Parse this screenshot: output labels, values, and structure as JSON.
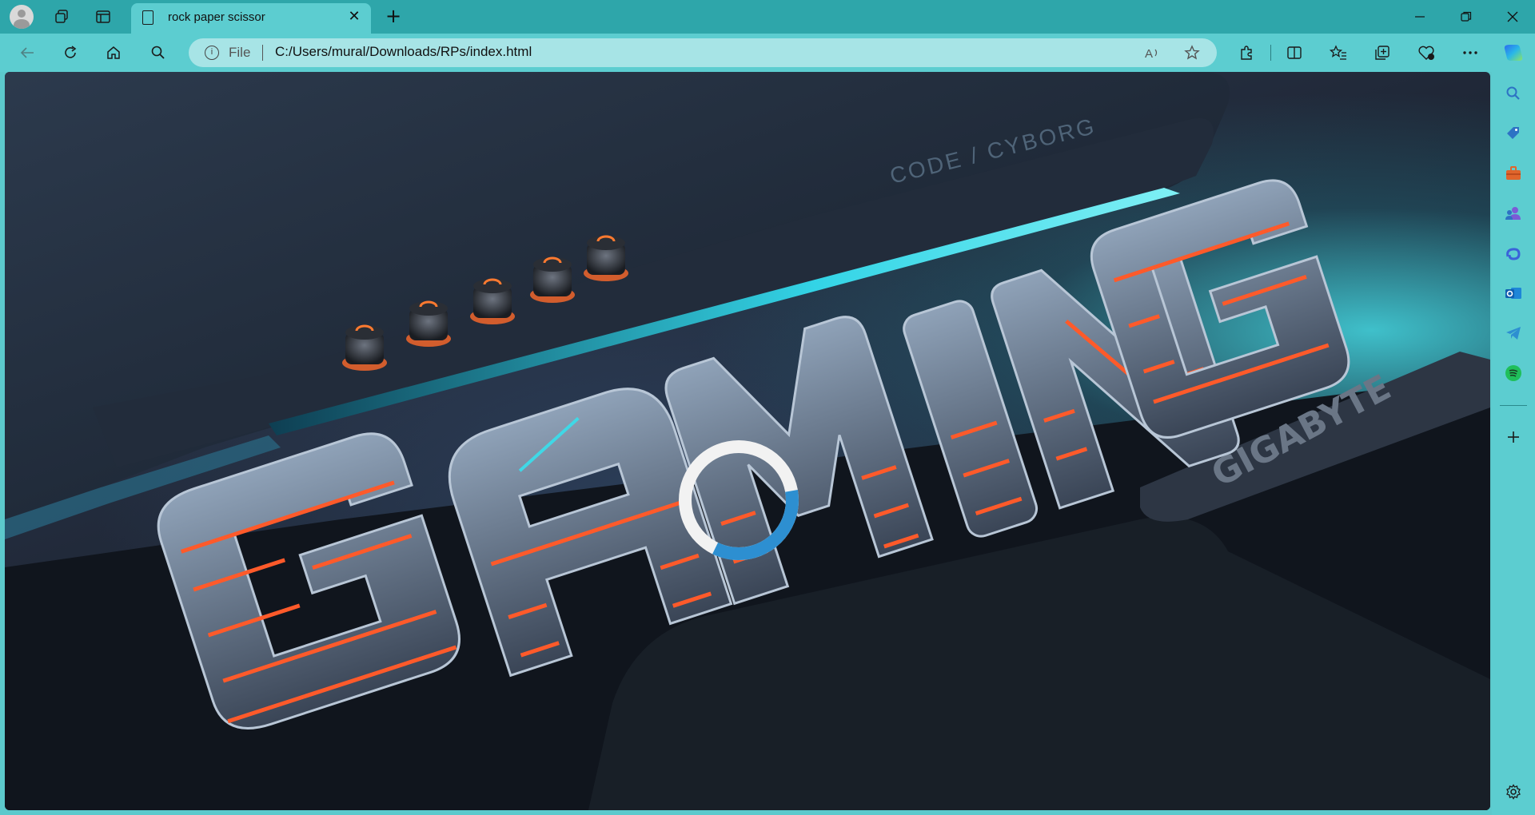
{
  "window": {
    "tab_title": "rock paper scissor",
    "new_tab_symbol": "+",
    "tab_close_symbol": "✕"
  },
  "toolbar": {
    "address_scheme_label": "File",
    "address_url": "C:/Users/mural/Downloads/RPs/index.html"
  },
  "page": {
    "background_words": {
      "header_text": "CODE / CYBORG",
      "brand_text": "GIGABYTE",
      "hero_text": "GAMING"
    },
    "loader": {
      "progress_fraction": 0.35
    }
  },
  "colors": {
    "titlebar": "#2ea6aa",
    "toolbar": "#5ccdd0",
    "address_bar": "#a7e4e6",
    "loader_track": "#f2f2f2",
    "loader_arc": "#2d8fd1",
    "neon_orange": "#ff5a2a",
    "neon_cyan": "#3fd8e6"
  },
  "icons": {
    "titlebar": [
      "profile-avatar-icon",
      "workspaces-icon",
      "tab-actions-icon",
      "document-icon"
    ],
    "toolbar": [
      "back-icon",
      "refresh-icon",
      "home-icon",
      "search-icon",
      "info-icon",
      "read-aloud-icon",
      "favorite-star-icon",
      "extensions-icon",
      "split-screen-icon",
      "favorites-icon",
      "collections-icon",
      "browser-essentials-icon",
      "more-icon",
      "copilot-icon"
    ],
    "sidebar": [
      "search-icon",
      "shopping-tag-icon",
      "tools-briefcase-icon",
      "people-icon",
      "copilot-swirl-icon",
      "outlook-icon",
      "telegram-icon",
      "spotify-icon",
      "add-icon",
      "settings-gear-icon"
    ]
  }
}
